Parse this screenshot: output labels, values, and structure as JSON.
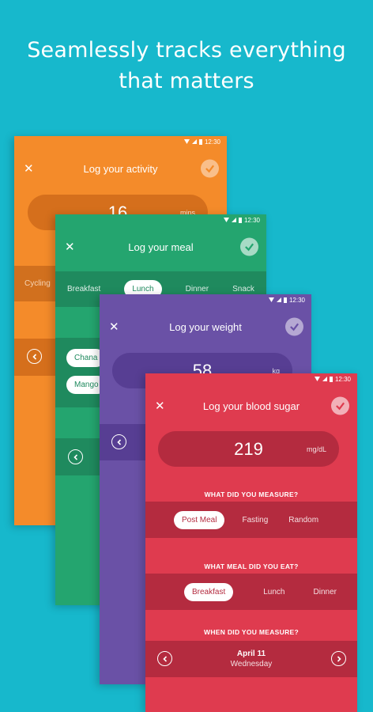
{
  "headline": {
    "line1": "Seamlessly tracks everything",
    "line2": "that matters"
  },
  "status_time": "12:30",
  "activity": {
    "title": "Log your activity",
    "value": "16",
    "unit": "mins",
    "chip": "Cycling"
  },
  "meal": {
    "title": "Log your meal",
    "tabs": [
      "Breakfast",
      "Lunch",
      "Dinner",
      "Snack"
    ],
    "selected_tab": "Lunch",
    "items": [
      "Chana",
      "Mango"
    ]
  },
  "weight": {
    "title": "Log your weight",
    "value": "58",
    "unit": "kg"
  },
  "blood_sugar": {
    "title": "Log your blood sugar",
    "value": "219",
    "unit": "mg/dL",
    "measure_label": "WHAT DID YOU MEASURE?",
    "measure_options": [
      "Post Meal",
      "Fasting",
      "Random"
    ],
    "meal_label": "WHAT MEAL DID YOU EAT?",
    "meal_options": [
      "Breakfast",
      "Lunch",
      "Dinner"
    ],
    "when_label": "WHEN DID YOU MEASURE?",
    "date": "April 11",
    "weekday": "Wednesday"
  },
  "colors": {
    "background": "#17b8cc",
    "activity": "#f48b2a",
    "meal": "#24a56f",
    "weight": "#6a51a6",
    "blood_sugar": "#df3b4f"
  }
}
